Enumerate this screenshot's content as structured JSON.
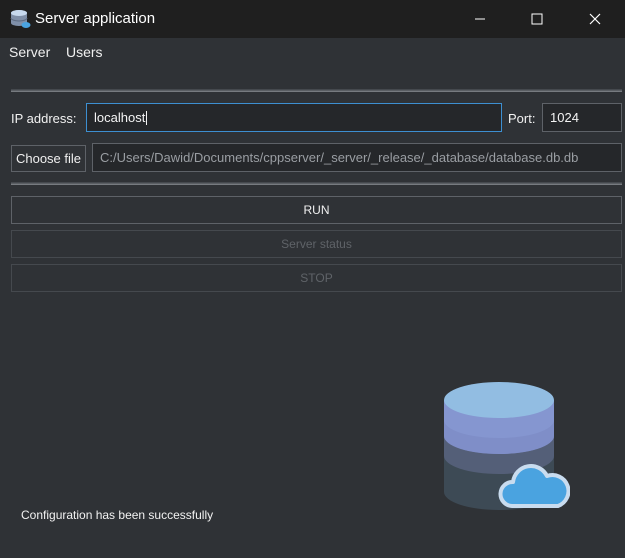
{
  "window": {
    "title": "Server application",
    "controls": [
      "minimize",
      "maximize",
      "close"
    ]
  },
  "menu": {
    "items": [
      "Server",
      "Users"
    ]
  },
  "form": {
    "ip_label": "IP address:",
    "ip_value": "localhost",
    "port_label": "Port:",
    "port_value": "1024",
    "choose_file_label": "Choose file",
    "file_path": "C:/Users/Dawid/Documents/cppserver/_server/_release/_database/database.db.db"
  },
  "buttons": {
    "run": "RUN",
    "server_status": "Server status",
    "stop": "STOP"
  },
  "status": {
    "message": "Configuration has been successfully"
  },
  "illustration": {
    "icon": "database-cloud-icon"
  },
  "colors": {
    "accent": "#3d8fd1",
    "window_bg": "#2f3236",
    "titlebar_bg": "#1f1f1f"
  }
}
